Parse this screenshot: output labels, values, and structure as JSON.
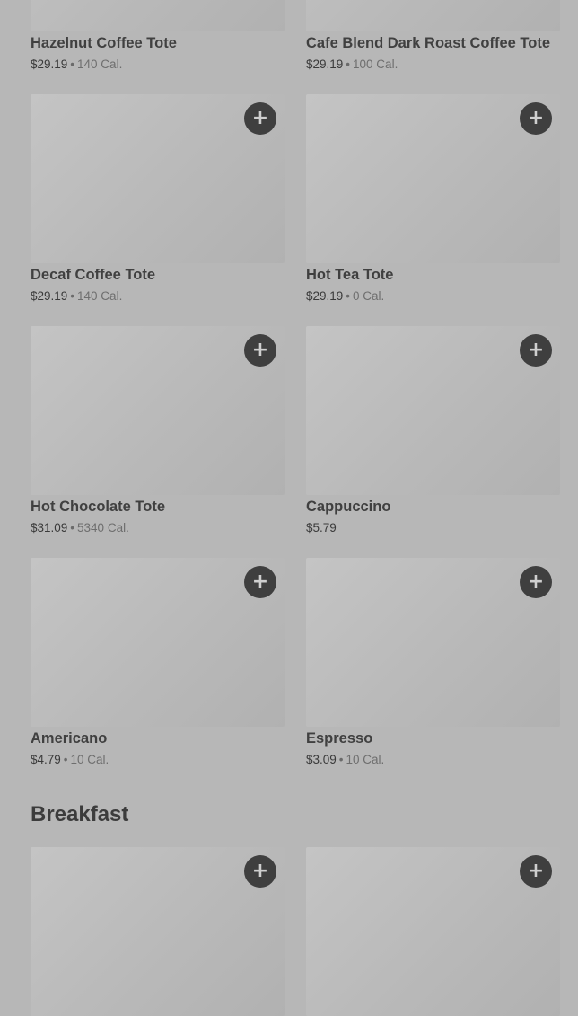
{
  "items_top": [
    {
      "name": "Hazelnut Coffee Tote",
      "price": "$29.19",
      "cal": "140 Cal."
    },
    {
      "name": "Cafe Blend Dark Roast Coffee Tote",
      "price": "$29.19",
      "cal": "100 Cal."
    }
  ],
  "items": [
    {
      "name": "Decaf Coffee Tote",
      "price": "$29.19",
      "cal": "140 Cal."
    },
    {
      "name": "Hot Tea Tote",
      "price": "$29.19",
      "cal": "0 Cal."
    },
    {
      "name": "Hot Chocolate Tote",
      "price": "$31.09",
      "cal": "5340 Cal."
    },
    {
      "name": "Cappuccino",
      "price": "$5.79",
      "cal": ""
    },
    {
      "name": "Americano",
      "price": "$4.79",
      "cal": "10 Cal."
    },
    {
      "name": "Espresso",
      "price": "$3.09",
      "cal": "10 Cal."
    }
  ],
  "section": {
    "title": "Breakfast"
  },
  "breakfast_items": [
    {},
    {}
  ],
  "add_symbol": "+",
  "separator": "•"
}
